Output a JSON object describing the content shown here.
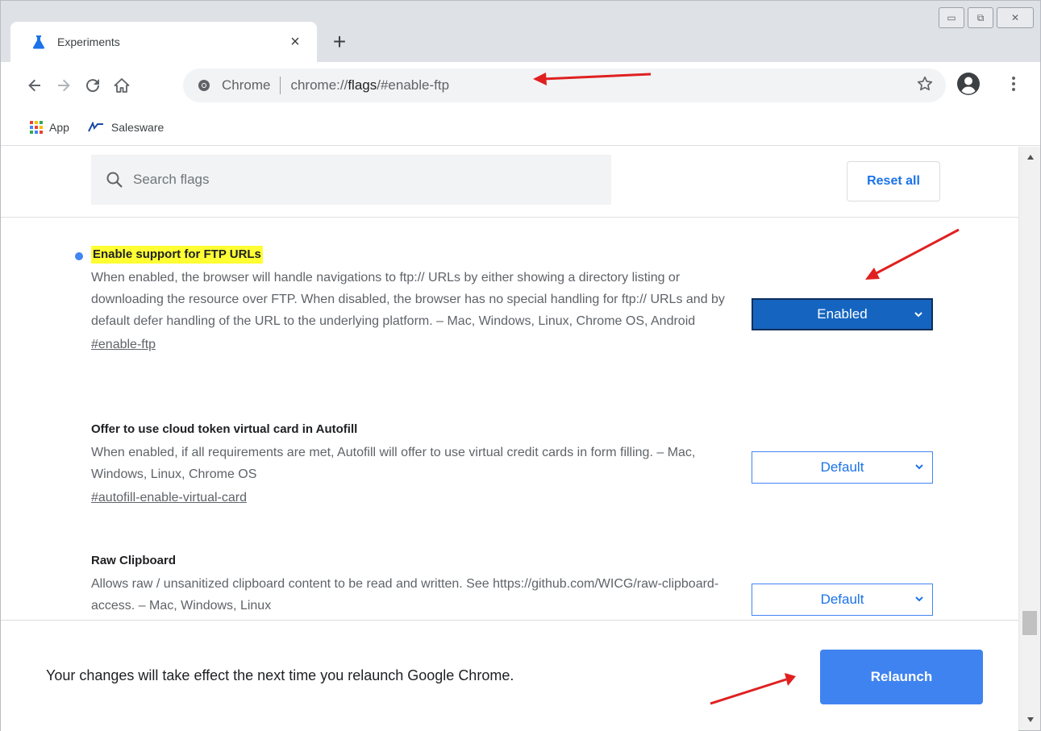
{
  "tab": {
    "title": "Experiments",
    "close": "×",
    "new_tab": "+"
  },
  "window_controls": {
    "minimize": "▭",
    "maximize": "⧉",
    "close": "✕"
  },
  "omnibox": {
    "origin": "Chrome",
    "url_prefix": "chrome://",
    "url_host": "flags",
    "url_suffix": "/#enable-ftp"
  },
  "bookmarks": [
    {
      "label": "App",
      "icon": "apps-grid-icon"
    },
    {
      "label": "Salesware",
      "icon": "salesware-logo-icon"
    }
  ],
  "header": {
    "search_placeholder": "Search flags",
    "reset_label": "Reset all"
  },
  "experiments": [
    {
      "title": "Enable support for FTP URLs",
      "description": "When enabled, the browser will handle navigations to ftp:// URLs by either showing a directory listing or downloading the resource over FTP. When disabled, the browser has no special handling for ftp:// URLs and by default defer handling of the URL to the underlying platform. – Mac, Windows, Linux, Chrome OS, Android",
      "link": "#enable-ftp",
      "value": "Enabled"
    },
    {
      "title": "Offer to use cloud token virtual card in Autofill",
      "description": "When enabled, if all requirements are met, Autofill will offer to use virtual credit cards in form filling. – Mac, Windows, Linux, Chrome OS",
      "link": "#autofill-enable-virtual-card",
      "value": "Default"
    },
    {
      "title": "Raw Clipboard",
      "description": "Allows raw / unsanitized clipboard content to be read and written. See https://github.com/WICG/raw-clipboard-access. – Mac, Windows, Linux",
      "link": "",
      "value": "Default"
    }
  ],
  "relaunch": {
    "message": "Your changes will take effect the next time you relaunch Google Chrome.",
    "button": "Relaunch"
  },
  "colors": {
    "accent": "#1a73e8",
    "enabled_select": "#1565c0",
    "relaunch_button": "#3f83f0",
    "highlight": "#ffff33",
    "annotation_arrow": "#e02020"
  }
}
